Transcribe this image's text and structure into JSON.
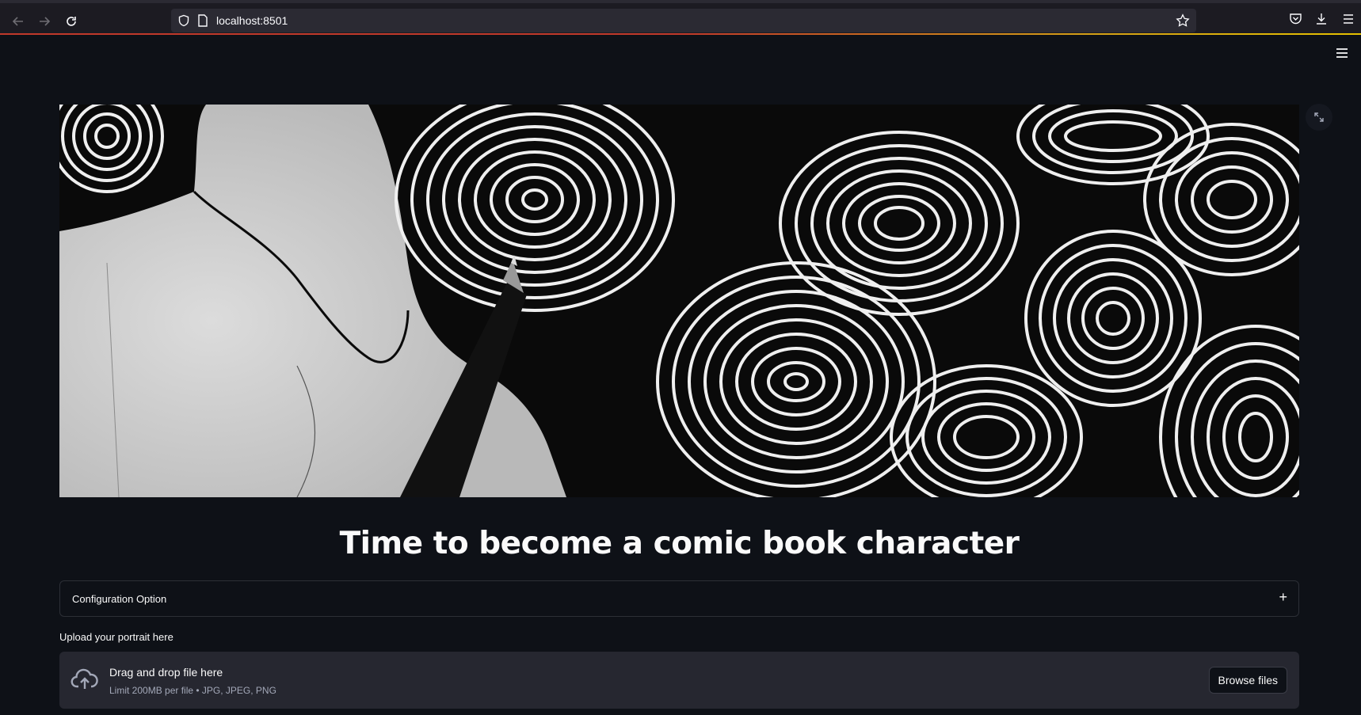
{
  "browser": {
    "url": "localhost:8501",
    "icons": [
      "back-arrow-icon",
      "forward-arrow-icon",
      "reload-icon",
      "shield-icon",
      "page-icon",
      "bookmark-star-icon",
      "pocket-icon",
      "download-icon",
      "menu-icon"
    ]
  },
  "app": {
    "hero_image": "black and white contour-line ink drawing with pen",
    "title": "Time to become a comic book character",
    "expander": {
      "label": "Configuration Option",
      "toggle": "+"
    },
    "uploader": {
      "label": "Upload your portrait here",
      "dropzone_title": "Drag and drop file here",
      "dropzone_hint": "Limit 200MB per file • JPG, JPEG, PNG",
      "button_label": "Browse files"
    }
  },
  "colors": {
    "background": "#0e1117",
    "dropzone": "#262730",
    "text": "#fafafa",
    "muted_text": "#a3a8b8"
  }
}
